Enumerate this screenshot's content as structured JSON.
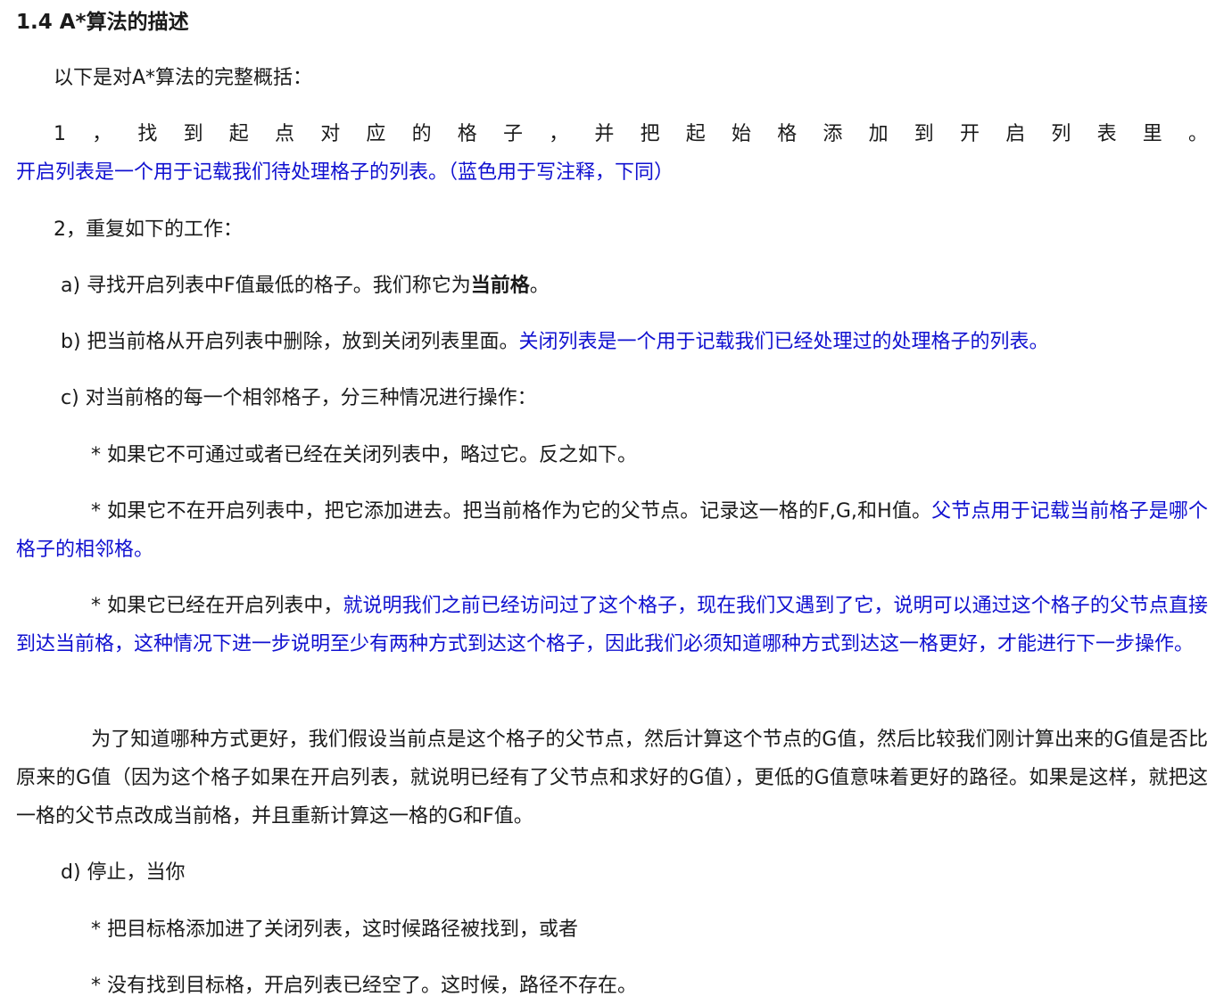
{
  "heading": "1.4 A*算法的描述",
  "intro": "以下是对A*算法的完整概括：",
  "step1": {
    "text": "1，找到起点对应的格子，并把起始格添加到开启列表里。",
    "note": "开启列表是一个用于记载我们待处理格子的列表。（蓝色用于写注释，下同）"
  },
  "step2": "2，重复如下的工作：",
  "step_a": {
    "text": "a) 寻找开启列表中F值最低的格子。我们称它为",
    "bold": "当前格",
    "end": "。"
  },
  "step_b": {
    "text": "b) 把当前格从开启列表中删除，放到关闭列表里面。",
    "note": "关闭列表是一个用于记载我们已经处理过的处理格子的列表。"
  },
  "step_c": "c) 对当前格的每一个相邻格子，分三种情况进行操作：",
  "c_case1": "* 如果它不可通过或者已经在关闭列表中，略过它。反之如下。",
  "c_case2": {
    "text": "* 如果它不在开启列表中，把它添加进去。把当前格作为它的父节点。记录这一格的F,G,和H值。",
    "note": "父节点用于记载当前格子是哪个格子的相邻格。"
  },
  "c_case3": {
    "text": "* 如果它已经在开启列表中，",
    "note": "就说明我们之前已经访问过了这个格子，现在我们又遇到了它，说明可以通过这个格子的父节点直接到达当前格，这种情况下进一步说明至少有两种方式到达这个格子，因此我们必须知道哪种方式到达这一格更好，才能进行下一步操作。"
  },
  "c_case3_detail": "为了知道哪种方式更好，我们假设当前点是这个格子的父节点，然后计算这个节点的G值，然后比较我们刚计算出来的G值是否比原来的G值（因为这个格子如果在开启列表，就说明已经有了父节点和求好的G值），更低的G值意味着更好的路径。如果是这样，就把这一格的父节点改成当前格，并且重新计算这一格的G和F值。",
  "step_d": "d) 停止，当你",
  "d_case1": "* 把目标格添加进了关闭列表，这时候路径被找到，或者",
  "d_case2": "* 没有找到目标格，开启列表已经空了。这时候，路径不存在。",
  "colors": {
    "text": "#1a1a1a",
    "annotation": "#1010d0"
  }
}
